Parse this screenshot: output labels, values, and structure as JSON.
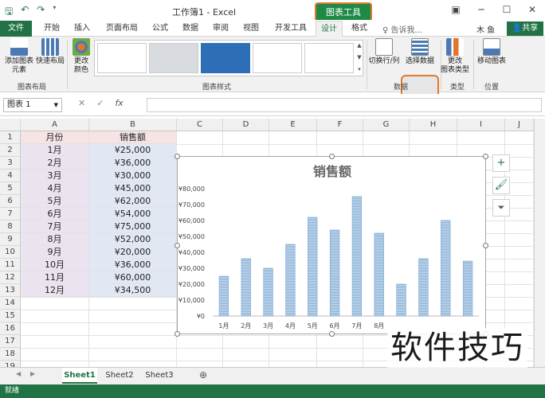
{
  "window": {
    "title": "工作簿1 - Excel",
    "context_tab_group": "图表工具"
  },
  "user": {
    "name": "木 鱼",
    "share": "共享"
  },
  "tabs": [
    "文件",
    "开始",
    "插入",
    "页面布局",
    "公式",
    "数据",
    "审阅",
    "视图",
    "开发工具",
    "设计",
    "格式"
  ],
  "active_tab": "设计",
  "tell_me": "告诉我...",
  "ribbon": {
    "add_element": "添加图表\n元素",
    "quick_layout": "快速布局",
    "change_colors": "更改\n颜色",
    "group_layout": "图表布局",
    "group_styles": "图表样式",
    "switch_row_col": "切换行/列",
    "select_data": "选择数据",
    "group_data": "数据",
    "change_type": "更改\n图表类型",
    "group_type": "类型",
    "move_chart": "移动图表",
    "group_location": "位置"
  },
  "formula_bar": {
    "name_box": "图表 1",
    "fx": "fx",
    "value": ""
  },
  "columns": [
    "A",
    "B",
    "C",
    "D",
    "E",
    "F",
    "G",
    "H",
    "I",
    "J"
  ],
  "rows": [
    "1",
    "2",
    "3",
    "4",
    "5",
    "6",
    "7",
    "8",
    "9",
    "10",
    "11",
    "12",
    "13",
    "14",
    "15",
    "16",
    "17",
    "18",
    "19"
  ],
  "table": {
    "header": [
      "月份",
      "销售额"
    ],
    "rows": [
      [
        "1月",
        "¥25,000"
      ],
      [
        "2月",
        "¥36,000"
      ],
      [
        "3月",
        "¥30,000"
      ],
      [
        "4月",
        "¥45,000"
      ],
      [
        "5月",
        "¥62,000"
      ],
      [
        "6月",
        "¥54,000"
      ],
      [
        "7月",
        "¥75,000"
      ],
      [
        "8月",
        "¥52,000"
      ],
      [
        "9月",
        "¥20,000"
      ],
      [
        "10月",
        "¥36,000"
      ],
      [
        "11月",
        "¥60,000"
      ],
      [
        "12月",
        "¥34,500"
      ]
    ]
  },
  "chart_data": {
    "type": "bar",
    "title": "销售额",
    "categories": [
      "1月",
      "2月",
      "3月",
      "4月",
      "5月",
      "6月",
      "7月",
      "8月"
    ],
    "values": [
      25000,
      36000,
      30000,
      45000,
      62000,
      54000,
      75000,
      52000,
      20000,
      36000,
      60000,
      34500
    ],
    "ylim": [
      0,
      80000
    ],
    "yticks": [
      "¥0",
      "¥10,000",
      "¥20,000",
      "¥30,000",
      "¥40,000",
      "¥50,000",
      "¥60,000",
      "¥70,000",
      "¥80,000"
    ],
    "bar_color": "#8eb4d8",
    "grid": false
  },
  "chart_tools": {
    "add": "+",
    "style": "brush",
    "filter": "filter"
  },
  "sheets": [
    "Sheet1",
    "Sheet2",
    "Sheet3"
  ],
  "status": "就绪",
  "watermark": "软件技巧",
  "colors": {
    "excel_green": "#217346",
    "highlight": "#e07a2d"
  }
}
